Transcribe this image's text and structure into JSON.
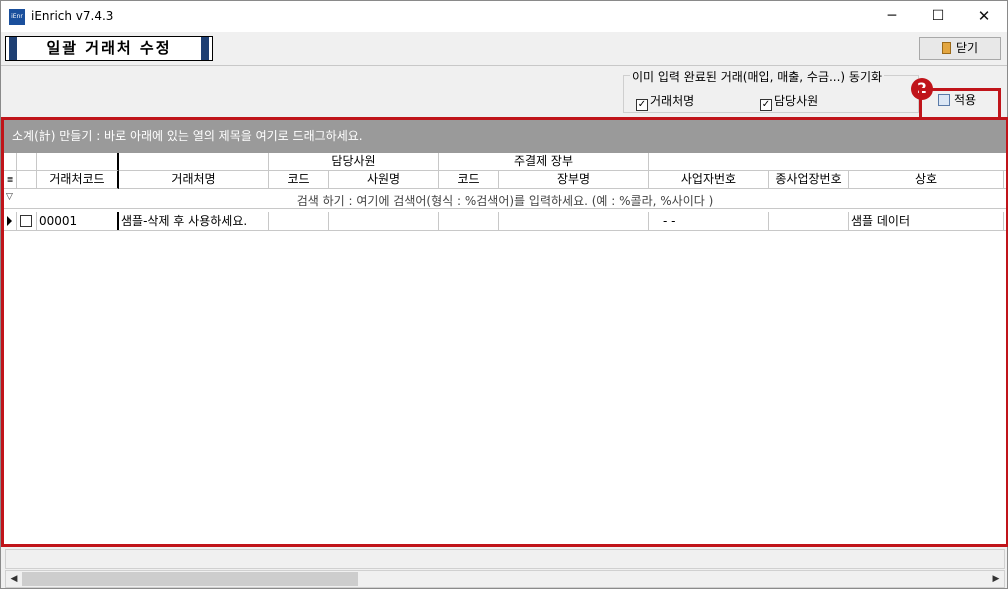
{
  "window": {
    "title": "iEnrich v7.4.3",
    "icon_label": "iEnr",
    "minimize_glyph": "─",
    "maximize_glyph": "☐",
    "close_glyph": "✕"
  },
  "header": {
    "screen_title": "일괄 거래처 수정",
    "close_button": "닫기"
  },
  "options": {
    "sync_legend": "이미 입력 완료된 거래(매입, 매출, 수금...) 동기화",
    "checkboxes": [
      {
        "label": "거래처명",
        "checked": true
      },
      {
        "label": "담당사원",
        "checked": true
      }
    ],
    "apply_button": "적용",
    "marker_number": "2"
  },
  "grid": {
    "group_panel_text": "소계(計) 만들기 : 바로 아래에 있는 열의 제목을 여기로 드래그하세요.",
    "group_headers": {
      "staff": "담당사원",
      "ledger": "주결제 장부"
    },
    "columns": {
      "client_code": "거래처코드",
      "client_name": "거래처명",
      "staff_code": "코드",
      "staff_name": "사원명",
      "ledger_code": "코드",
      "ledger_name": "장부명",
      "biz_no": "사업자번호",
      "branch_no": "종사업장번호",
      "company_name": "상호"
    },
    "filter_text": "검색 하기 : 여기에 검색어(형식 : %검색어)를 입력하세요. (예 : %콜라, %사이다 )",
    "rows": [
      {
        "client_code": "00001",
        "client_name": "샘플-삭제 후 사용하세요.",
        "staff_code": "",
        "staff_name": "",
        "ledger_code": "",
        "ledger_name": "",
        "biz_no": "-  -",
        "branch_no": "",
        "company_name": "샘플 데이터"
      }
    ]
  },
  "colors": {
    "highlight": "#c0141a",
    "group_panel": "#9a9a9a",
    "title_bar_accent": "#1e3f73"
  }
}
